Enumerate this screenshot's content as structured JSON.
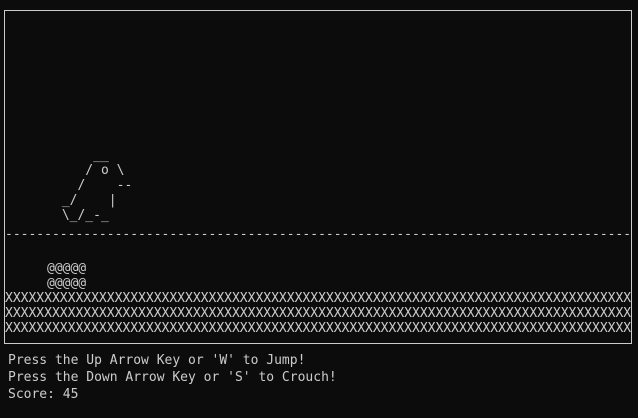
{
  "game": {
    "player_sprite": "     __\n    / o \\\n   /    --\n _/    |\n \\_/_-_",
    "ground_line": "------------------------------------------------------------------------------------------",
    "obstacle_sprite": "@@@@@\n@@@@@",
    "floor_rows": "XXXXXXXXXXXXXXXXXXXXXXXXXXXXXXXXXXXXXXXXXXXXXXXXXXXXXXXXXXXXXXXXXXXXXXXXXXXXXXXXXX\nXXXXXXXXXXXXXXXXXXXXXXXXXXXXXXXXXXXXXXXXXXXXXXXXXXXXXXXXXXXXXXXXXXXXXXXXXXXXXXXXXX\nXXXXXXXXXXXXXXXXXXXXXXXXXXXXXXXXXXXXXXXXXXXXXXXXXXXXXXXXXXXXXXXXXXXXXXXXXXXXXXXXXX"
  },
  "instructions": {
    "jump": "Press the Up Arrow Key or 'W' to Jump!",
    "crouch": "Press the Down Arrow Key or 'S' to Crouch!"
  },
  "score": {
    "text": "Score: 45"
  }
}
